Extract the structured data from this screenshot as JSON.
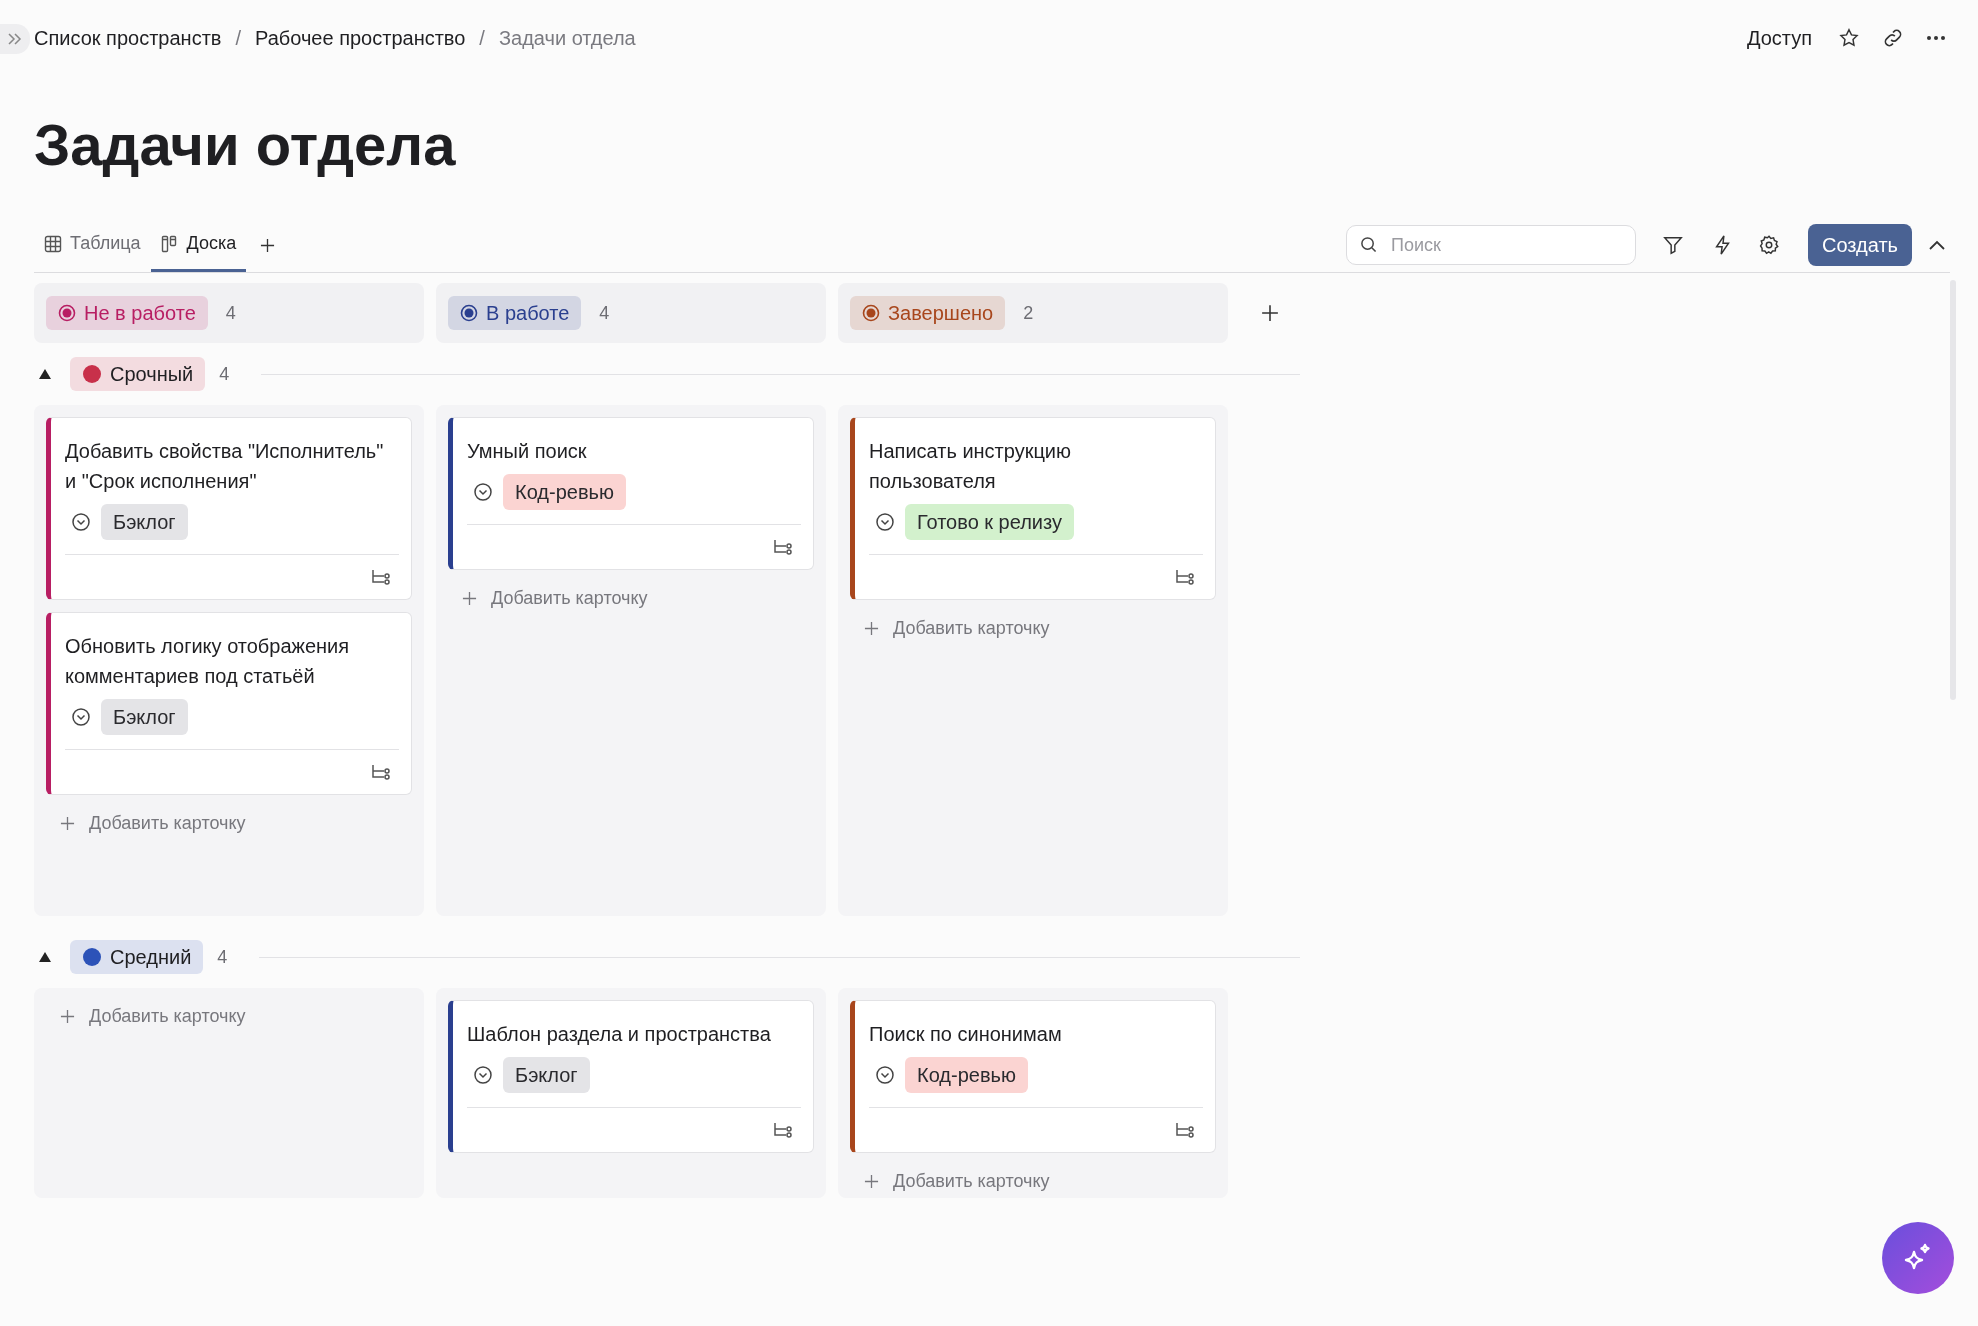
{
  "breadcrumbs": [
    {
      "label": "Список пространств",
      "current": false
    },
    {
      "label": "Рабочее пространство",
      "current": false
    },
    {
      "label": "Задачи отдела",
      "current": true
    }
  ],
  "breadcrumb_separator": "/",
  "top_actions": {
    "access": "Доступ"
  },
  "title": "Задачи отдела",
  "views": [
    {
      "label": "Таблица",
      "kind": "table",
      "selected": false
    },
    {
      "label": "Доска",
      "kind": "board",
      "selected": true
    }
  ],
  "search": {
    "placeholder": "Поиск"
  },
  "create_button": "Создать",
  "columns": [
    {
      "label": "Не в работе",
      "count": "4",
      "color": "#b81e63"
    },
    {
      "label": "В работе",
      "count": "4",
      "color": "#2a3f8f"
    },
    {
      "label": "Завершено",
      "count": "2",
      "color": "#a8461c"
    }
  ],
  "groups": [
    {
      "label": "Срочный",
      "count": "4",
      "color": "#c8304a",
      "expanded": true,
      "cells": [
        {
          "cards": [
            {
              "title": "Добавить свойства \"Исполнитель\" и \"Срок исполнения\"",
              "tag": {
                "label": "Бэклог",
                "color": "#e4e4e7"
              }
            },
            {
              "title": "Обновить логику отображения комментариев под статьёй",
              "tag": {
                "label": "Бэклог",
                "color": "#e4e4e7"
              }
            }
          ],
          "add_card": "Добавить карточку"
        },
        {
          "cards": [
            {
              "title": "Умный поиск",
              "tag": {
                "label": "Код-ревью",
                "color": "#fbd4d2"
              }
            }
          ],
          "add_card": "Добавить карточку"
        },
        {
          "cards": [
            {
              "title": "Написать инструкцию пользователя",
              "tag": {
                "label": "Готово к релизу",
                "color": "#d3f1cd"
              }
            }
          ],
          "add_card": "Добавить карточку"
        }
      ]
    },
    {
      "label": "Средний",
      "count": "4",
      "color": "#2c52b8",
      "expanded": true,
      "cells": [
        {
          "add_card": "Добавить карточку"
        },
        {
          "cards": [
            {
              "title": "Шаблон раздела и пространства",
              "tag": {
                "label": "Бэклог",
                "color": "#e4e4e7"
              }
            }
          ]
        },
        {
          "cards": [
            {
              "title": "Поиск по синонимам",
              "tag": {
                "label": "Код-ревью",
                "color": "#fbd4d2"
              }
            }
          ],
          "add_card": "Добавить карточку"
        }
      ]
    }
  ]
}
